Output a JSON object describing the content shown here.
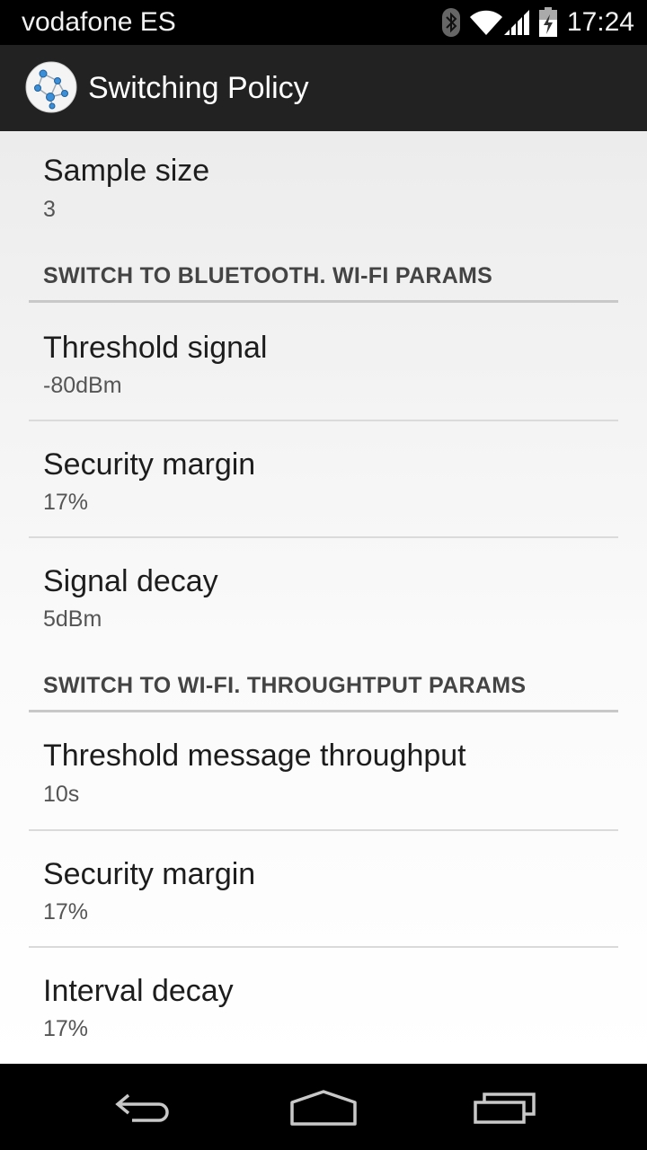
{
  "status_bar": {
    "carrier": "vodafone ES",
    "time": "17:24",
    "icons": [
      "bluetooth-icon",
      "wifi-icon",
      "cell-signal-icon",
      "battery-icon"
    ]
  },
  "action_bar": {
    "title": "Switching Policy",
    "icon": "app-network-icon"
  },
  "preferences": {
    "sample_size": {
      "title": "Sample size",
      "summary": "3"
    },
    "bluetooth_category": "SWITCH TO BLUETOOTH. WI-FI PARAMS",
    "threshold_signal": {
      "title": "Threshold signal",
      "summary": "-80dBm"
    },
    "security_margin_bt": {
      "title": "Security margin",
      "summary": "17%"
    },
    "signal_decay": {
      "title": "Signal decay",
      "summary": "5dBm"
    },
    "wifi_category": "SWITCH TO WI-FI. THROUGHTPUT PARAMS",
    "threshold_throughput": {
      "title": "Threshold message throughput",
      "summary": "10s"
    },
    "security_margin_wifi": {
      "title": "Security margin",
      "summary": "17%"
    },
    "interval_decay": {
      "title": "Interval decay",
      "summary": "17%"
    }
  },
  "nav_bar": {
    "icons": [
      "back-icon",
      "home-icon",
      "recents-icon"
    ]
  }
}
